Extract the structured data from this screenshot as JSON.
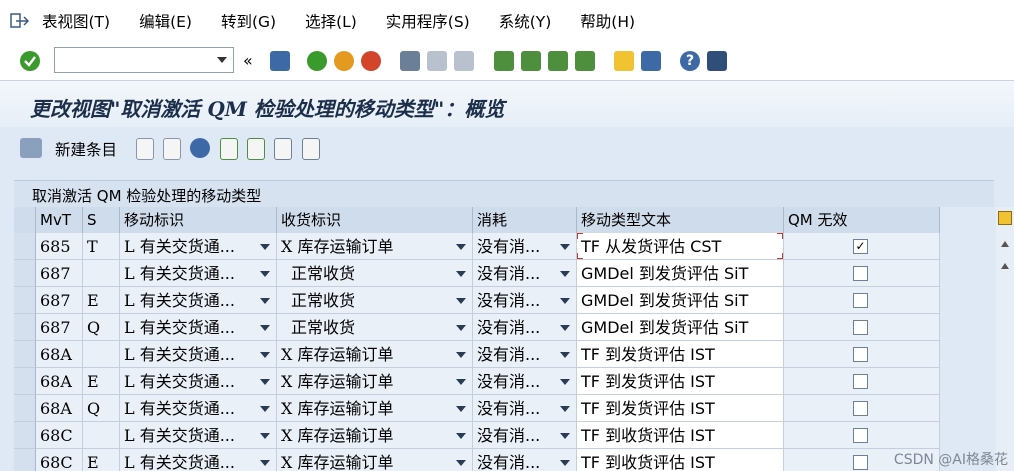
{
  "menu": {
    "items": [
      "表视图(T)",
      "编辑(E)",
      "转到(G)",
      "选择(L)",
      "实用程序(S)",
      "系统(Y)",
      "帮助(H)"
    ]
  },
  "toolbar": {
    "command_value": ""
  },
  "title": "更改视图\"取消激活 QM 检验处理的移动类型\"：概览",
  "app_toolbar": {
    "new_entries_label": "新建条目"
  },
  "panel_title": "取消激活 QM 检验处理的移动类型",
  "table": {
    "headers": [
      "MvT",
      "S",
      "移动标识",
      "收货标识",
      "消耗",
      "移动类型文本",
      "QM 无效"
    ],
    "rows": [
      {
        "mvt": "685",
        "s": "T",
        "move": "L 有关交货通...",
        "gr": "X 库存运输订单",
        "cons": "没有消...",
        "text": "TF 从发货评估 CST",
        "qm": true
      },
      {
        "mvt": "687",
        "s": "",
        "move": "L 有关交货通...",
        "gr": "正常收货",
        "cons": "没有消...",
        "text": "GMDel 到发货评估 SiT",
        "qm": false
      },
      {
        "mvt": "687",
        "s": "E",
        "move": "L 有关交货通...",
        "gr": "正常收货",
        "cons": "没有消...",
        "text": "GMDel 到发货评估 SiT",
        "qm": false
      },
      {
        "mvt": "687",
        "s": "Q",
        "move": "L 有关交货通...",
        "gr": "正常收货",
        "cons": "没有消...",
        "text": "GMDel 到发货评估 SiT",
        "qm": false
      },
      {
        "mvt": "68A",
        "s": "",
        "move": "L 有关交货通...",
        "gr": "X 库存运输订单",
        "cons": "没有消...",
        "text": "TF 到发货评估 IST",
        "qm": false
      },
      {
        "mvt": "68A",
        "s": "E",
        "move": "L 有关交货通...",
        "gr": "X 库存运输订单",
        "cons": "没有消...",
        "text": "TF 到发货评估 IST",
        "qm": false
      },
      {
        "mvt": "68A",
        "s": "Q",
        "move": "L 有关交货通...",
        "gr": "X 库存运输订单",
        "cons": "没有消...",
        "text": "TF 到发货评估 IST",
        "qm": false
      },
      {
        "mvt": "68C",
        "s": "",
        "move": "L 有关交货通...",
        "gr": "X 库存运输订单",
        "cons": "没有消...",
        "text": "TF 到收货评估 IST",
        "qm": false
      },
      {
        "mvt": "68C",
        "s": "E",
        "move": "L 有关交货通...",
        "gr": "X 库存运输订单",
        "cons": "没有消...",
        "text": "TF 到收货评估 IST",
        "qm": false
      }
    ]
  },
  "watermark": "CSDN @AI格桑花",
  "colors": {
    "accent_green": "#3a9a2b",
    "title_text": "#1c2f4a",
    "focus_corner": "#c0392b"
  }
}
